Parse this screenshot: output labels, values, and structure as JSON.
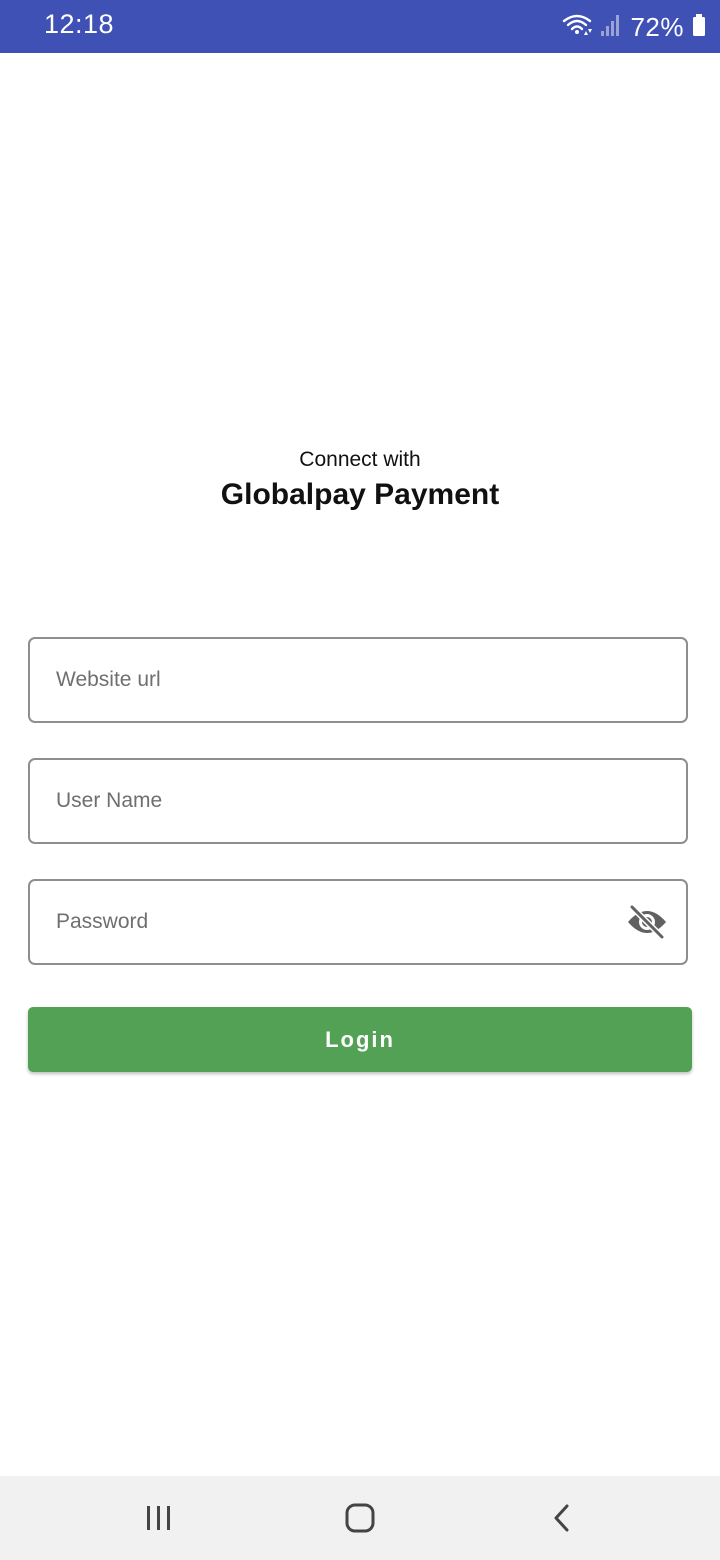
{
  "status_bar": {
    "time": "12:18",
    "battery_percent": "72%",
    "icons": [
      "wifi-icon",
      "signal-icon",
      "battery-icon"
    ],
    "background_color": "#3f51b5"
  },
  "header": {
    "subtitle": "Connect with",
    "title": "Globalpay Payment"
  },
  "form": {
    "website_url": {
      "placeholder": "Website url",
      "value": ""
    },
    "user_name": {
      "placeholder": "User Name",
      "value": ""
    },
    "password": {
      "placeholder": "Password",
      "value": "",
      "toggle_icon": "eye-off-icon"
    }
  },
  "login_button": {
    "label": "Login",
    "color": "#53a155"
  },
  "nav_bar": {
    "buttons": [
      "recents-icon",
      "home-icon",
      "back-icon"
    ]
  }
}
